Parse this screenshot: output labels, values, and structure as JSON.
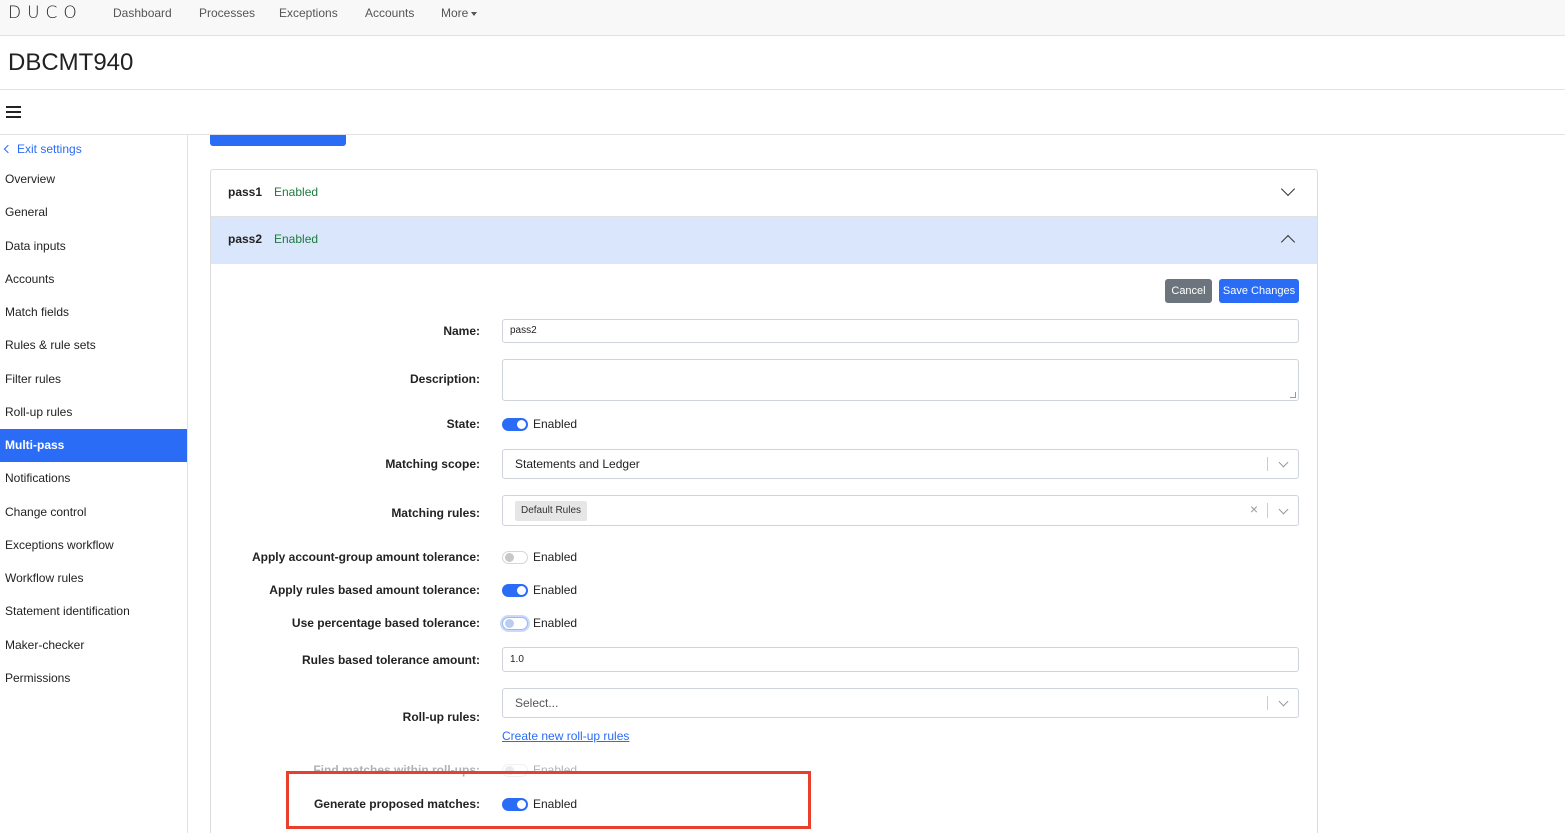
{
  "nav": {
    "logo": "DUCO",
    "links": [
      "Dashboard",
      "Processes",
      "Exceptions",
      "Accounts",
      "More"
    ]
  },
  "page": {
    "title": "DBCMT940"
  },
  "sidebar": {
    "exit_label": "Exit settings",
    "items": [
      {
        "label": "Overview"
      },
      {
        "label": "General"
      },
      {
        "label": "Data inputs"
      },
      {
        "label": "Accounts"
      },
      {
        "label": "Match fields"
      },
      {
        "label": "Rules & rule sets"
      },
      {
        "label": "Filter rules"
      },
      {
        "label": "Roll-up rules"
      },
      {
        "label": "Multi-pass",
        "active": true
      },
      {
        "label": "Notifications"
      },
      {
        "label": "Change control"
      },
      {
        "label": "Exceptions workflow"
      },
      {
        "label": "Workflow rules"
      },
      {
        "label": "Statement identification"
      },
      {
        "label": "Maker-checker"
      },
      {
        "label": "Permissions"
      }
    ]
  },
  "passes": [
    {
      "name": "pass1",
      "status": "Enabled",
      "expanded": false
    },
    {
      "name": "pass2",
      "status": "Enabled",
      "expanded": true
    }
  ],
  "form": {
    "cancel_label": "Cancel",
    "save_label": "Save Changes",
    "name": {
      "label": "Name:",
      "value": "pass2"
    },
    "description": {
      "label": "Description:",
      "value": ""
    },
    "state": {
      "label": "State:",
      "value": "Enabled",
      "on": true
    },
    "matching_scope": {
      "label": "Matching scope:",
      "value": "Statements and Ledger"
    },
    "matching_rules": {
      "label": "Matching rules:",
      "tag": "Default Rules",
      "clear_icon": "×"
    },
    "account_group_tolerance": {
      "label": "Apply account-group amount tolerance:",
      "value": "Enabled",
      "on": false
    },
    "rules_based_tolerance": {
      "label": "Apply rules based amount tolerance:",
      "value": "Enabled",
      "on": true
    },
    "percentage_tolerance": {
      "label": "Use percentage based tolerance:",
      "value": "Enabled",
      "on": false
    },
    "tolerance_amount": {
      "label": "Rules based tolerance amount:",
      "value": "1.0"
    },
    "rollup_rules": {
      "label": "Roll-up rules:",
      "placeholder": "Select...",
      "link": "Create new roll-up rules"
    },
    "find_within_rollups": {
      "label": "Find matches within roll-ups:",
      "value": "Enabled",
      "on": false
    },
    "generate_proposed": {
      "label": "Generate proposed matches:",
      "value": "Enabled",
      "on": true
    }
  },
  "colors": {
    "accent": "#2b6cf6",
    "enabled_text": "#1c7b3d",
    "highlight": "#e8402c",
    "active_row": "#d9e6fb"
  }
}
